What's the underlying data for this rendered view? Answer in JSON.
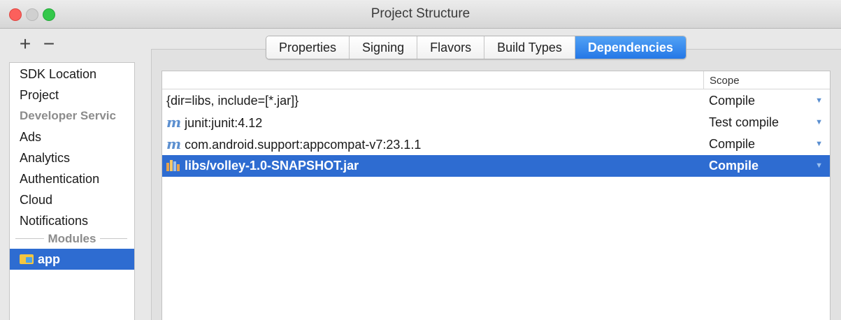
{
  "window": {
    "title": "Project Structure"
  },
  "toolbar": {
    "add_label": "+",
    "remove_label": "−"
  },
  "sidebar": {
    "items": [
      {
        "label": "SDK Location",
        "type": "item"
      },
      {
        "label": "Project",
        "type": "item"
      },
      {
        "label": "Developer Servic",
        "type": "header"
      },
      {
        "label": "Ads",
        "type": "item"
      },
      {
        "label": "Analytics",
        "type": "item"
      },
      {
        "label": "Authentication",
        "type": "item"
      },
      {
        "label": "Cloud",
        "type": "item"
      },
      {
        "label": "Notifications",
        "type": "item"
      }
    ],
    "modules_label": "Modules",
    "modules": [
      {
        "label": "app",
        "selected": true,
        "icon": "module-folder-icon"
      }
    ]
  },
  "tabs": [
    {
      "label": "Properties",
      "active": false
    },
    {
      "label": "Signing",
      "active": false
    },
    {
      "label": "Flavors",
      "active": false
    },
    {
      "label": "Build Types",
      "active": false
    },
    {
      "label": "Dependencies",
      "active": true
    }
  ],
  "table": {
    "scope_header": "Scope",
    "rows": [
      {
        "icon": "none",
        "dependency": "{dir=libs, include=[*.jar]}",
        "scope": "Compile",
        "selected": false
      },
      {
        "icon": "maven-icon",
        "icon_glyph": "m",
        "dependency": "junit:junit:4.12",
        "scope": "Test compile",
        "selected": false
      },
      {
        "icon": "maven-icon",
        "icon_glyph": "m",
        "dependency": "com.android.support:appcompat-v7:23.1.1",
        "scope": "Compile",
        "selected": false
      },
      {
        "icon": "jar-library-icon",
        "dependency": "libs/volley-1.0-SNAPSHOT.jar",
        "scope": "Compile",
        "selected": true
      }
    ],
    "dropdown_glyph": "▼"
  },
  "colors": {
    "selection": "#2e6cd1",
    "tab_active": "#2477e6",
    "maven_icon": "#5b8fd0",
    "close_button": "#fc605c",
    "max_button": "#34c84a"
  }
}
